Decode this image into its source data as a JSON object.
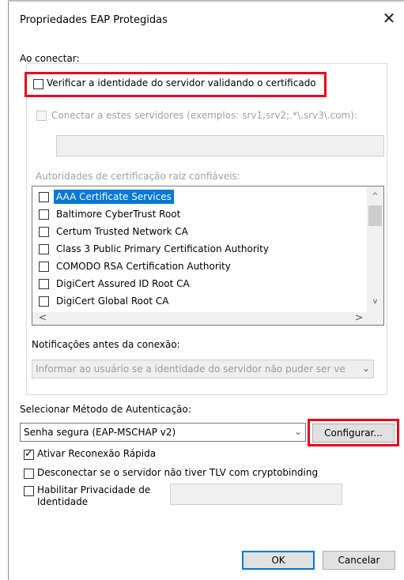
{
  "window": {
    "title": "Propriedades EAP Protegidas",
    "close_glyph": "✕"
  },
  "connect": {
    "heading": "Ao conectar:",
    "verify_label": "Verificar a identidade do servidor validando o certificado",
    "verify_checked": false,
    "servers_label": "Conectar a estes servidores (exemplos: srv1;srv2;.*\\.srv3\\.com):",
    "servers_value": "",
    "ca_heading": "Autoridades de certificação raiz confiáveis:",
    "ca_list": [
      {
        "label": "AAA Certificate Services",
        "selected": true
      },
      {
        "label": "Baltimore CyberTrust Root",
        "selected": false
      },
      {
        "label": "Certum Trusted Network CA",
        "selected": false
      },
      {
        "label": "Class 3 Public Primary Certification Authority",
        "selected": false
      },
      {
        "label": "COMODO RSA Certification Authority",
        "selected": false
      },
      {
        "label": "DigiCert Assured ID Root CA",
        "selected": false
      },
      {
        "label": "DigiCert Global Root CA",
        "selected": false
      }
    ],
    "notifications_heading": "Notificações antes da conexão:",
    "notifications_value": "Informar ao usuário se a identidade do servidor não puder ser ve"
  },
  "auth": {
    "heading": "Selecionar Método de Autenticação:",
    "method_value": "Senha segura (EAP-MSCHAP v2)",
    "configure_label": "Configurar..."
  },
  "options": {
    "fast_reconnect_label": "Ativar Reconexão Rápida",
    "fast_reconnect_checked": true,
    "disconnect_label": "Desconectar se o servidor não tiver TLV com cryptobinding",
    "privacy_label_line1": "Habilitar Privacidade de",
    "privacy_label_line2": "Identidade",
    "privacy_value": ""
  },
  "buttons": {
    "ok": "OK",
    "cancel": "Cancelar"
  },
  "colors": {
    "highlight_box": "#e8001c",
    "selection": "#0078d7",
    "default_button_border": "#0078d7"
  },
  "icons": {
    "scroll_up": "^",
    "scroll_down": "v",
    "scroll_left": "<",
    "scroll_right": ">",
    "dropdown": "chevron-down-icon"
  }
}
